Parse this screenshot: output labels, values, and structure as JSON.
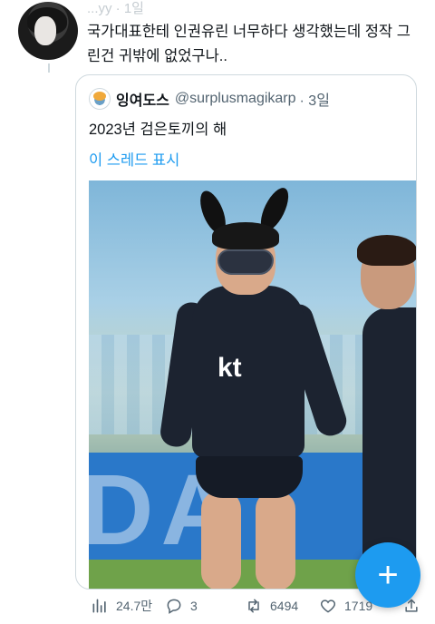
{
  "tweet": {
    "header_text": "...yy · 1일",
    "text": "국가대표한테 인권유린 너무하다 생각했는데 정작 그린건 귀밖에 없었구나..",
    "avatar_icon": "user-avatar"
  },
  "quote": {
    "display_name": "잉여도스",
    "handle": "@surplusmagikarp",
    "time": "· 3일",
    "text": "2023년 검은토끼의 해",
    "show_thread": "이 스레드 표시",
    "photo_board_text": "DA"
  },
  "fab": {
    "label": "+",
    "icon": "compose-plus-icon",
    "color": "#1d9bf0"
  },
  "actions": {
    "views": "24.7만",
    "replies": "3",
    "retweets": "6494",
    "likes": "1719"
  },
  "colors": {
    "accent": "#1d9bf0",
    "muted": "#536471",
    "border": "#cfd9de"
  }
}
